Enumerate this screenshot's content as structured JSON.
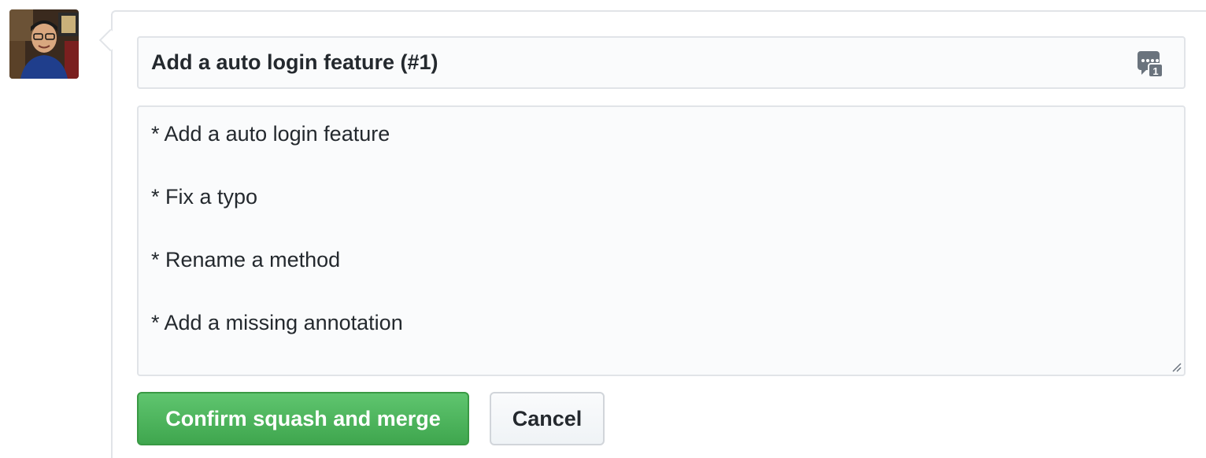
{
  "commit_title": "Add a auto login feature (#1)",
  "commit_body_lines": [
    "* Add a auto login feature",
    "",
    "* Fix a typo",
    "",
    "* Rename a method",
    "",
    "* Add a missing annotation"
  ],
  "buttons": {
    "confirm_label": "Confirm squash and merge",
    "cancel_label": "Cancel"
  },
  "saved_replies_icon": {
    "icon": "saved-replies-icon",
    "badge": "1"
  },
  "colors": {
    "confirm_green": "#3fa64e",
    "border_gray": "#e1e4e8",
    "field_bg": "#fafbfc"
  }
}
